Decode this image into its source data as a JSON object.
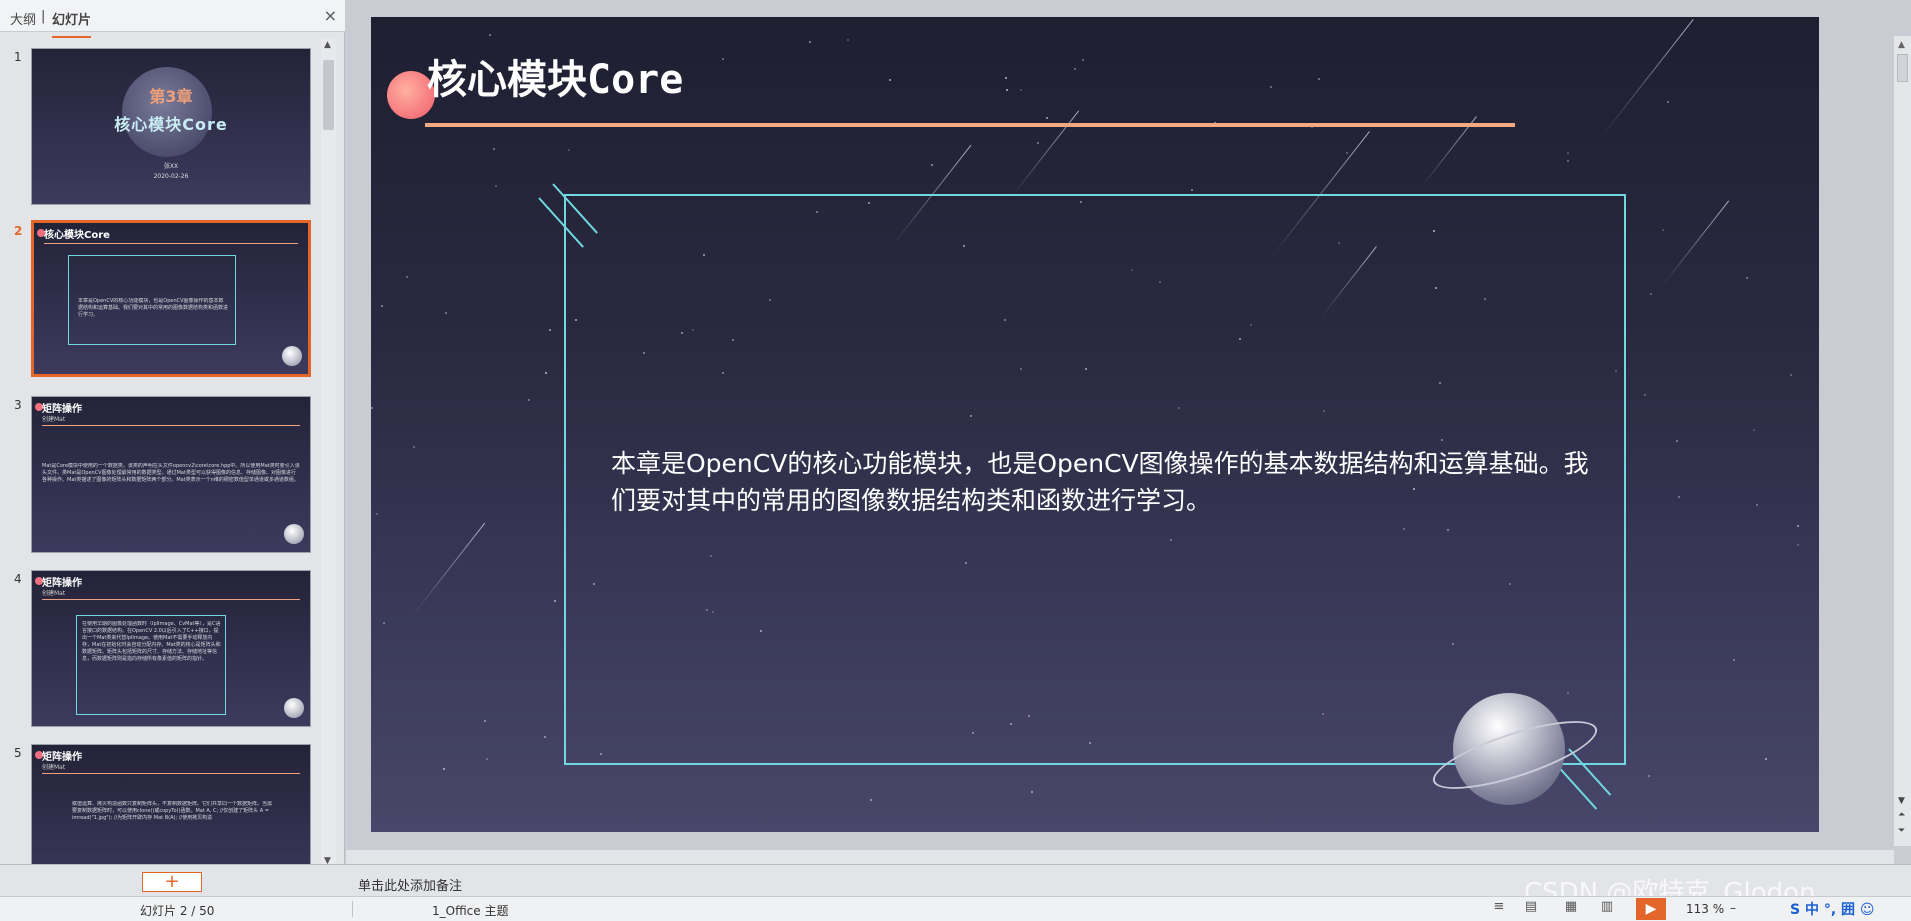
{
  "left_panel": {
    "tab_outline": "大纲",
    "tab_separator": "|",
    "tab_slides": "幻灯片",
    "close_icon": "×",
    "thumbnails": [
      {
        "num": "1",
        "chapter": "第3章",
        "title": "核心模块Core",
        "author": "张XX",
        "date": "2020-02-26"
      },
      {
        "num": "2",
        "title": "核心模块Core",
        "body": "本章是OpenCV的核心功能模块，也是OpenCV图像操作的基本数据结构和运算基础。我们要对其中的常用的图像数据结构类和函数进行学习。"
      },
      {
        "num": "3",
        "title": "矩阵操作",
        "subtitle": "创建Mat",
        "body": "Mat是Core模块中使用的一个数据类。该类的声明在头文件opencv2\\core\\core.hpp中。所以使用Mat类时要引入该头文件。类Mat是OpenCV图像处理最常用的数据类型，通过Mat类型可以获得图像的信息、存储图像、对图像进行各种操作。Mat类描述了图像的矩阵头和数据矩阵两个部分。Mat类表示一个n维的稠密数值型单通道或多通道数组。"
      },
      {
        "num": "4",
        "title": "矩阵操作",
        "subtitle": "创建Mat",
        "body": "在使用早期的图像处理函数时（IplImage、CvMat等），是C语言接口的数据结构。在OpenCV 2.0以后引入了C++接口，提出一个Mat类来代替IplImage。使用Mat不需要手动释放内存，Mat在初始化时会自动分配内存。Mat类的核心是矩阵头和数据矩阵。矩阵头包括矩阵的尺寸、存储方法、存储地址等信息，而数据矩阵则是指向存储所有像素值的矩阵的指针。"
      },
      {
        "num": "5",
        "title": "矩阵操作",
        "subtitle": "创建Mat",
        "body": "赋值运算、拷贝构造函数只复制矩阵头，不复制数据矩阵。它们共享同一个数据矩阵。当需要复制数据矩阵时，可以使用clone()或copyTo()函数。Mat A, C; //仅创建了矩阵头 A = imread(\"1.jpg\"); //为矩阵开辟内存 Mat B(A); //使用拷贝构造"
      }
    ]
  },
  "slide": {
    "title": "核心模块Core",
    "body": "本章是OpenCV的核心功能模块，也是OpenCV图像操作的基本数据结构和运算基础。我们要对其中的常用的图像数据结构类和函数进行学习。"
  },
  "notes_placeholder": "单击此处添加备注",
  "add_slide_icon": "+",
  "status": {
    "slide_info": "幻灯片 2 / 50",
    "theme": "1_Office 主题",
    "zoom": "113 %",
    "zoom_minus": "–"
  },
  "watermark": "CSDN @欧特克_Glodon",
  "ime": "S 中 °, 囲 ☺",
  "colors": {
    "accent": "#e2662a",
    "frame": "#6fd8e0",
    "title_line": "#f4a882"
  }
}
